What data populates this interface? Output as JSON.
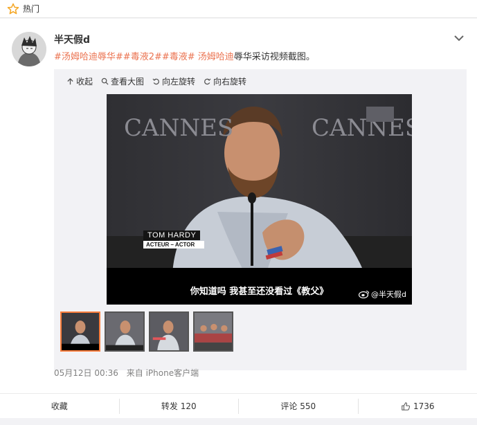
{
  "topbar": {
    "label": "热门",
    "icon": "star-icon"
  },
  "post": {
    "username": "半天假d",
    "tags": [
      "#汤姆哈迪辱华#",
      "#毒液2#",
      "#毒液#"
    ],
    "mention": "汤姆哈迪",
    "text_suffix": "辱华采访视频截图。",
    "timestamp": "05月12日 00:36",
    "source": "来自 iPhone客户端"
  },
  "media": {
    "tools": [
      "收起",
      "查看大图",
      "向左旋转",
      "向右旋转"
    ],
    "subtitle": "你知道吗 我甚至还没看过《教父》",
    "watermark": "@半天假d",
    "nametag_name": "TOM HARDY",
    "nametag_role": "ACTEUR – ACTOR",
    "backdrop_text_left": "CANNES",
    "backdrop_text_right": "CANNES"
  },
  "actions": {
    "favorite": "收藏",
    "repost": "转发 120",
    "comment": "评论 550",
    "like": "1736"
  },
  "colors": {
    "accent": "#eb7350",
    "thumb_active": "#fa7d3c"
  }
}
